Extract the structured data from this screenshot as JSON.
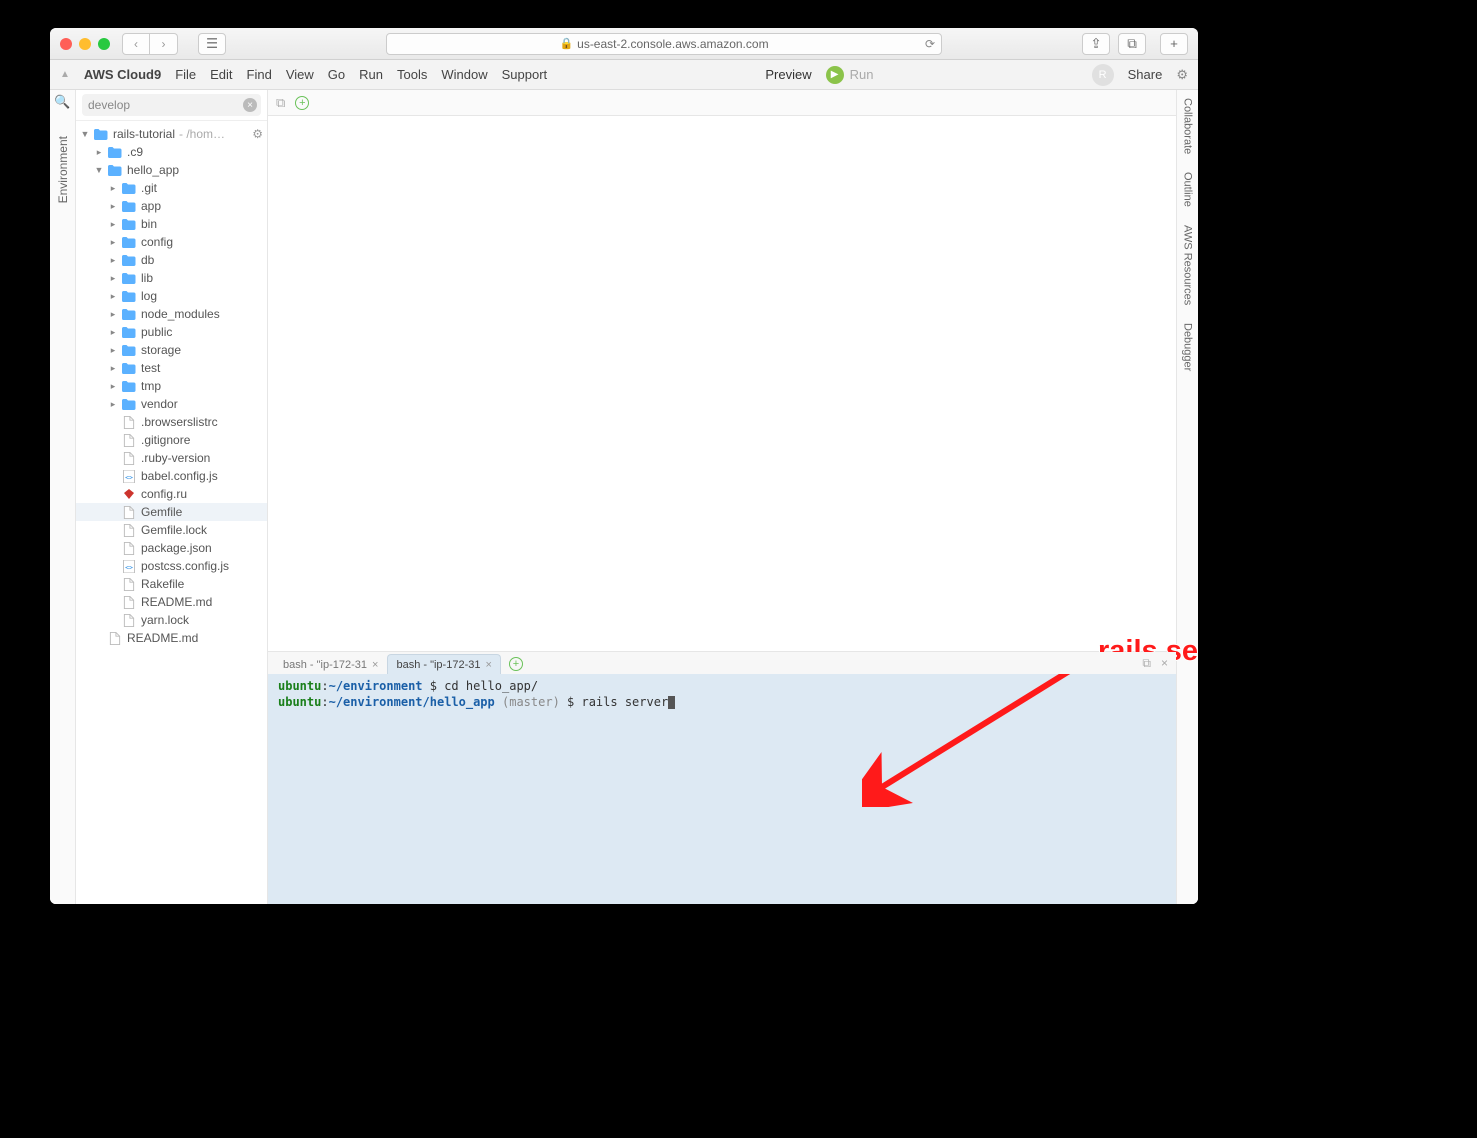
{
  "browser": {
    "url": "us-east-2.console.aws.amazon.com"
  },
  "menu": {
    "brand": "AWS Cloud9",
    "items": [
      "File",
      "Edit",
      "Find",
      "View",
      "Go",
      "Run",
      "Tools",
      "Window",
      "Support"
    ],
    "preview": "Preview",
    "run": "Run",
    "share": "Share",
    "avatar": "R"
  },
  "left_rail": {
    "label": "Environment"
  },
  "right_rail": {
    "labels": [
      "Collaborate",
      "Outline",
      "AWS Resources",
      "Debugger"
    ]
  },
  "tree": {
    "search_value": "develop",
    "root": {
      "name": "rails-tutorial",
      "suffix": "- /hom…"
    },
    "items": [
      {
        "depth": 1,
        "type": "folder",
        "name": ".c9",
        "expanded": false
      },
      {
        "depth": 1,
        "type": "folder",
        "name": "hello_app",
        "expanded": true
      },
      {
        "depth": 2,
        "type": "folder",
        "name": ".git",
        "expanded": false
      },
      {
        "depth": 2,
        "type": "folder",
        "name": "app",
        "expanded": false
      },
      {
        "depth": 2,
        "type": "folder",
        "name": "bin",
        "expanded": false
      },
      {
        "depth": 2,
        "type": "folder",
        "name": "config",
        "expanded": false
      },
      {
        "depth": 2,
        "type": "folder",
        "name": "db",
        "expanded": false
      },
      {
        "depth": 2,
        "type": "folder",
        "name": "lib",
        "expanded": false
      },
      {
        "depth": 2,
        "type": "folder",
        "name": "log",
        "expanded": false
      },
      {
        "depth": 2,
        "type": "folder",
        "name": "node_modules",
        "expanded": false
      },
      {
        "depth": 2,
        "type": "folder",
        "name": "public",
        "expanded": false
      },
      {
        "depth": 2,
        "type": "folder",
        "name": "storage",
        "expanded": false
      },
      {
        "depth": 2,
        "type": "folder",
        "name": "test",
        "expanded": false
      },
      {
        "depth": 2,
        "type": "folder",
        "name": "tmp",
        "expanded": false
      },
      {
        "depth": 2,
        "type": "folder",
        "name": "vendor",
        "expanded": false
      },
      {
        "depth": 2,
        "type": "file",
        "icon": "file",
        "name": ".browserslistrc"
      },
      {
        "depth": 2,
        "type": "file",
        "icon": "file",
        "name": ".gitignore"
      },
      {
        "depth": 2,
        "type": "file",
        "icon": "file",
        "name": ".ruby-version"
      },
      {
        "depth": 2,
        "type": "file",
        "icon": "js",
        "name": "babel.config.js"
      },
      {
        "depth": 2,
        "type": "file",
        "icon": "ruby",
        "name": "config.ru"
      },
      {
        "depth": 2,
        "type": "file",
        "icon": "file",
        "name": "Gemfile",
        "selected": true
      },
      {
        "depth": 2,
        "type": "file",
        "icon": "file",
        "name": "Gemfile.lock"
      },
      {
        "depth": 2,
        "type": "file",
        "icon": "file",
        "name": "package.json"
      },
      {
        "depth": 2,
        "type": "file",
        "icon": "js",
        "name": "postcss.config.js"
      },
      {
        "depth": 2,
        "type": "file",
        "icon": "file",
        "name": "Rakefile"
      },
      {
        "depth": 2,
        "type": "file",
        "icon": "file",
        "name": "README.md"
      },
      {
        "depth": 2,
        "type": "file",
        "icon": "file",
        "name": "yarn.lock"
      },
      {
        "depth": 1,
        "type": "file",
        "icon": "file",
        "name": "README.md"
      }
    ]
  },
  "terminal": {
    "tabs": [
      {
        "label": "bash - \"ip-172-31",
        "active": false
      },
      {
        "label": "bash - \"ip-172-31",
        "active": true
      }
    ],
    "lines": [
      {
        "user": "ubuntu",
        "sep": ":",
        "path": "~/environment",
        "branch": "",
        "prompt": " $ ",
        "cmd": "cd hello_app/"
      },
      {
        "user": "ubuntu",
        "sep": ":",
        "path": "~/environment/hello_app",
        "branch": " (master)",
        "prompt": " $ ",
        "cmd": "rails server",
        "cursor": true
      }
    ]
  },
  "annotation": {
    "text": "rails server"
  }
}
